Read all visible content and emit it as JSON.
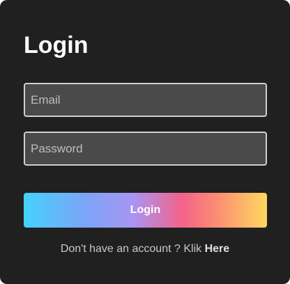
{
  "form": {
    "title": "Login",
    "email": {
      "placeholder": "Email",
      "value": ""
    },
    "password": {
      "placeholder": "Password",
      "value": ""
    },
    "login_label": "Login",
    "signup_prompt": "Don't have an account ? Klik",
    "signup_link": "Here"
  },
  "colors": {
    "card_background": "#202020",
    "field_background": "#4a4a4a",
    "gradient": [
      "#45d2fc",
      "#a895f2",
      "#f3628a",
      "#fed85f"
    ]
  }
}
